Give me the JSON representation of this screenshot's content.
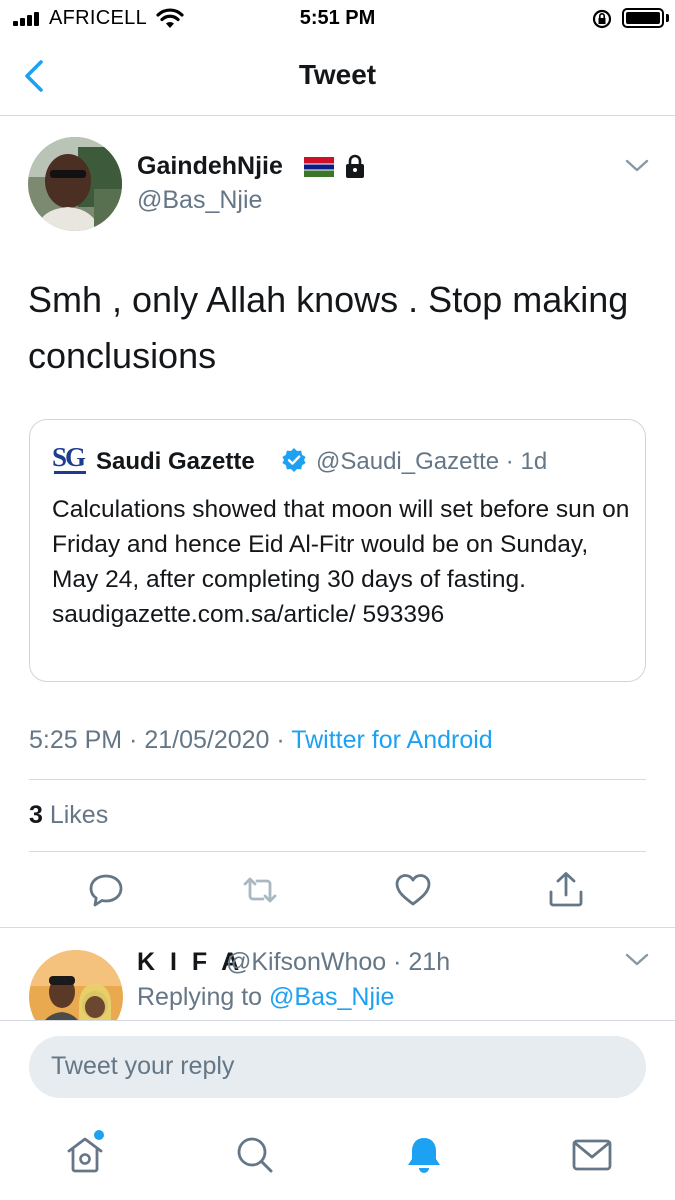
{
  "status_bar": {
    "carrier": "AFRICELL",
    "time": "5:51 PM",
    "icons": [
      "signal-icon",
      "wifi-icon",
      "rotation-lock-icon",
      "battery-icon"
    ]
  },
  "nav": {
    "title": "Tweet",
    "back_icon": "chevron-left-icon"
  },
  "tweet": {
    "author_name": "GaindehNjie",
    "author_handle": "@Bas_Njie",
    "flag_icon": "gambia-flag-icon",
    "text": "Smh , only Allah knows . Stop making conclusions",
    "quote": {
      "name": "Saudi Gazette",
      "logo_text": "SG",
      "handle_time": "@Saudi_Gazette · 1d",
      "text": "Calculations showed that moon will set before sun on Friday and hence Eid Al-Fitr would be on Sunday, May 24, after completing 30 days of fasting.  saudigazette.com.sa/article/ 593396"
    },
    "timestamp": "5:25 PM · 21/05/2020 · ",
    "source": "Twitter for Android",
    "likes_count": "3",
    "likes_label": " Likes",
    "actions": [
      "reply-icon",
      "retweet-icon",
      "like-icon",
      "share-icon"
    ]
  },
  "reply": {
    "name": "K I F A",
    "handle_time": "@KifsonWhoo · 21h",
    "replying_to_label": "Replying to ",
    "replying_to_handle": "@Bas_Njie"
  },
  "compose": {
    "placeholder": "Tweet your reply"
  },
  "tabs": [
    "home-icon",
    "search-icon",
    "notifications-icon",
    "messages-icon"
  ],
  "colors": {
    "accent": "#1da1f2",
    "text": "#14171a",
    "secondary": "#657786",
    "border": "#d5dbe0",
    "retweet_disabled": "#aab8c2"
  }
}
